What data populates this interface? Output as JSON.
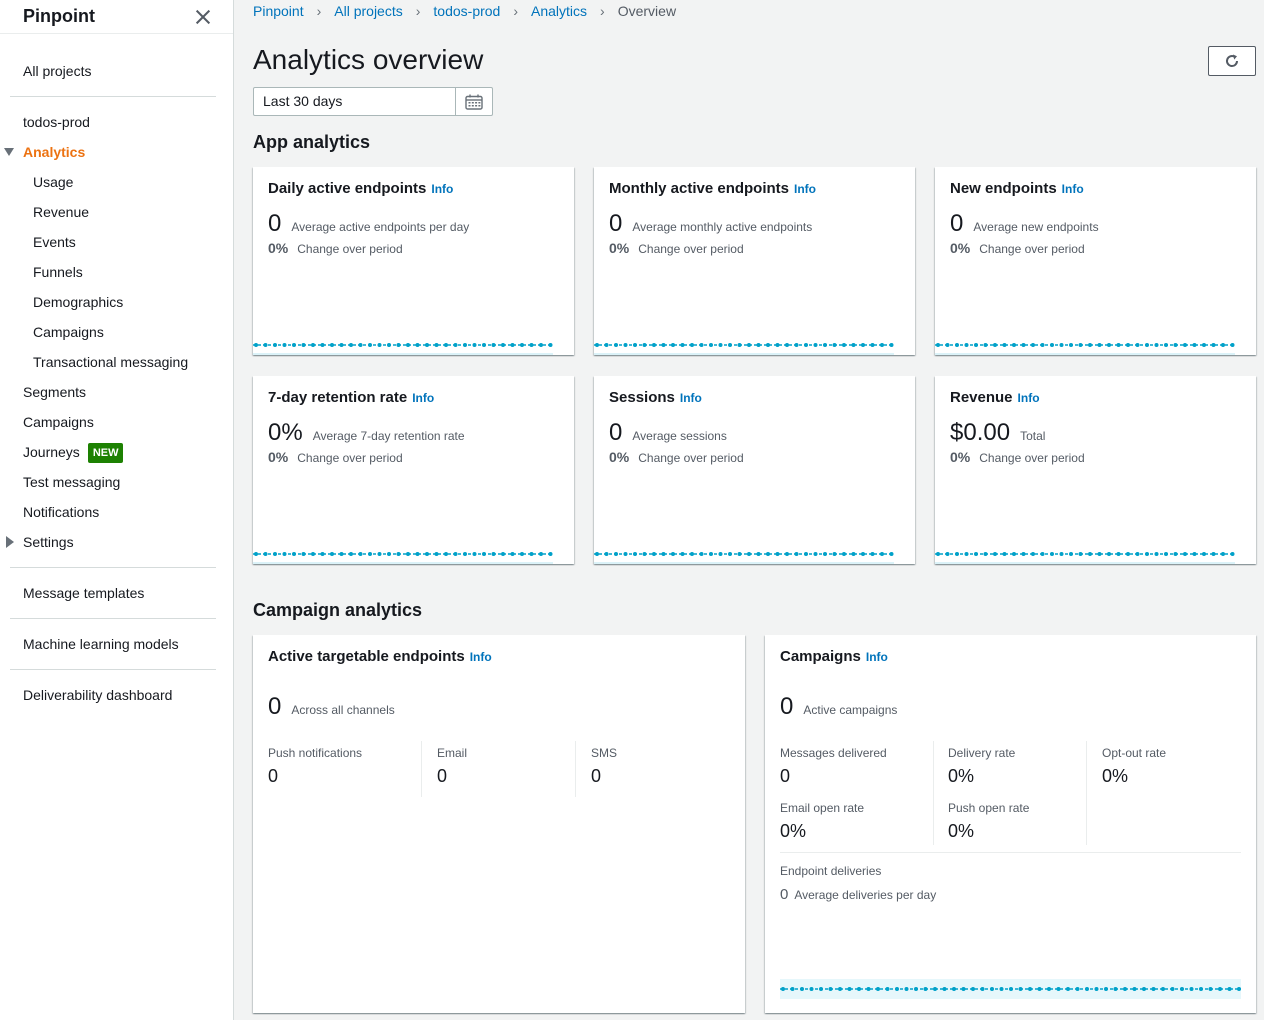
{
  "sidebar": {
    "title": "Pinpoint",
    "all_projects": "All projects",
    "project": "todos-prod",
    "analytics": "Analytics",
    "analytics_items": [
      "Usage",
      "Revenue",
      "Events",
      "Funnels",
      "Demographics",
      "Campaigns",
      "Transactional messaging"
    ],
    "segments": "Segments",
    "campaigns": "Campaigns",
    "journeys": "Journeys",
    "journeys_badge": "NEW",
    "test_messaging": "Test messaging",
    "notifications": "Notifications",
    "settings": "Settings",
    "message_templates": "Message templates",
    "ml_models": "Machine learning models",
    "deliverability": "Deliverability dashboard"
  },
  "breadcrumb": [
    "Pinpoint",
    "All projects",
    "todos-prod",
    "Analytics",
    "Overview"
  ],
  "page_title": "Analytics overview",
  "date_range": "Last 30 days",
  "app_analytics": {
    "title": "App analytics",
    "cards": [
      {
        "title": "Daily active endpoints",
        "info": "Info",
        "value": "0",
        "desc": "Average active endpoints per day",
        "change": "0%",
        "change_desc": "Change over period"
      },
      {
        "title": "Monthly active endpoints",
        "info": "Info",
        "value": "0",
        "desc": "Average monthly active endpoints",
        "change": "0%",
        "change_desc": "Change over period"
      },
      {
        "title": "New endpoints",
        "info": "Info",
        "value": "0",
        "desc": "Average new endpoints",
        "change": "0%",
        "change_desc": "Change over period"
      },
      {
        "title": "7-day retention rate",
        "info": "Info",
        "value": "0%",
        "desc": "Average 7-day retention rate",
        "change": "0%",
        "change_desc": "Change over period"
      },
      {
        "title": "Sessions",
        "info": "Info",
        "value": "0",
        "desc": "Average sessions",
        "change": "0%",
        "change_desc": "Change over period"
      },
      {
        "title": "Revenue",
        "info": "Info",
        "value": "$0.00",
        "desc": "Total",
        "change": "0%",
        "change_desc": "Change over period"
      }
    ]
  },
  "campaign_analytics": {
    "title": "Campaign analytics",
    "targetable": {
      "title": "Active targetable endpoints",
      "info": "Info",
      "value": "0",
      "desc": "Across all channels",
      "channels": [
        {
          "label": "Push notifications",
          "value": "0"
        },
        {
          "label": "Email",
          "value": "0"
        },
        {
          "label": "SMS",
          "value": "0"
        }
      ]
    },
    "campaigns": {
      "title": "Campaigns",
      "info": "Info",
      "value": "0",
      "desc": "Active campaigns",
      "messages_delivered_label": "Messages delivered",
      "messages_delivered": "0",
      "delivery_rate_label": "Delivery rate",
      "delivery_rate": "0%",
      "optout_rate_label": "Opt-out rate",
      "optout_rate": "0%",
      "email_open_label": "Email open rate",
      "email_open": "0%",
      "push_open_label": "Push open rate",
      "push_open": "0%",
      "endpoint_deliveries_label": "Endpoint deliveries",
      "endpoint_deliveries": "0",
      "endpoint_deliveries_desc": "Average deliveries per day"
    }
  },
  "colors": {
    "accent": "#ec7211",
    "link": "#0073bb",
    "sparkline": "#00a1c9",
    "badge": "#1d8102"
  }
}
